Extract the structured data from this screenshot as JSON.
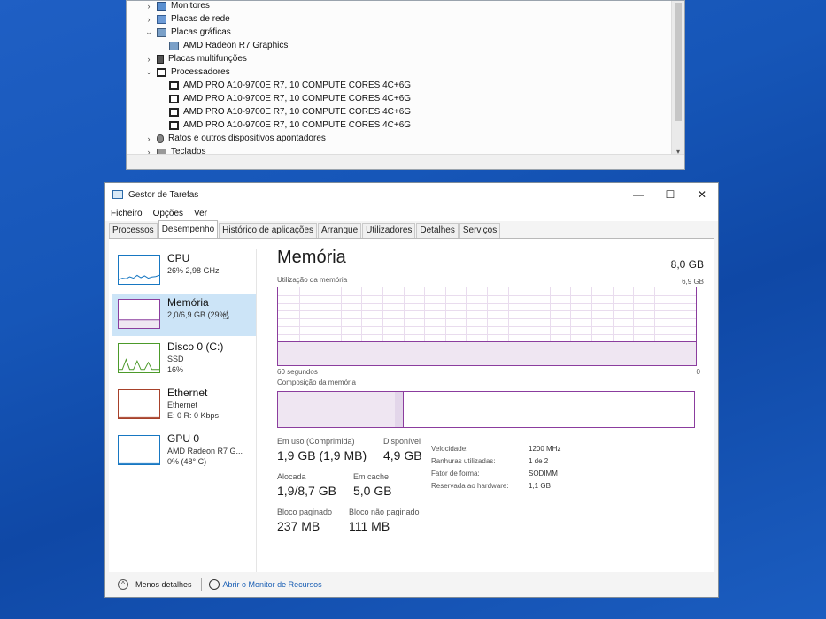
{
  "device_manager": {
    "rows": [
      {
        "chevron": ">",
        "icon": "monitor-icon",
        "label": "Monitores",
        "indent": 0
      },
      {
        "chevron": ">",
        "icon": "network-adapter-icon",
        "label": "Placas de rede",
        "indent": 0
      },
      {
        "chevron": "v",
        "icon": "display-adapter-icon",
        "label": "Placas gráficas",
        "indent": 0
      },
      {
        "chevron": "",
        "icon": "display-adapter-icon",
        "label": "AMD Radeon R7 Graphics",
        "indent": 1
      },
      {
        "chevron": ">",
        "icon": "multifunction-card-icon",
        "label": "Placas multifunções",
        "indent": 0
      },
      {
        "chevron": "v",
        "icon": "processor-icon",
        "label": "Processadores",
        "indent": 0
      },
      {
        "chevron": "",
        "icon": "processor-icon",
        "label": "AMD PRO A10-9700E R7, 10 COMPUTE CORES 4C+6G",
        "indent": 1
      },
      {
        "chevron": "",
        "icon": "processor-icon",
        "label": "AMD PRO A10-9700E R7, 10 COMPUTE CORES 4C+6G",
        "indent": 1
      },
      {
        "chevron": "",
        "icon": "processor-icon",
        "label": "AMD PRO A10-9700E R7, 10 COMPUTE CORES 4C+6G",
        "indent": 1
      },
      {
        "chevron": "",
        "icon": "processor-icon",
        "label": "AMD PRO A10-9700E R7, 10 COMPUTE CORES 4C+6G",
        "indent": 1
      },
      {
        "chevron": ">",
        "icon": "mouse-icon",
        "label": "Ratos e outros dispositivos apontadores",
        "indent": 0
      },
      {
        "chevron": ">",
        "icon": "keyboard-icon",
        "label": "Teclados",
        "indent": 0
      }
    ]
  },
  "task_manager": {
    "title": "Gestor de Tarefas",
    "window_controls": {
      "minimize": "—",
      "maximize": "☐",
      "close": "✕"
    },
    "menu": [
      "Ficheiro",
      "Opções",
      "Ver"
    ],
    "tabs": [
      "Processos",
      "Desempenho",
      "Histórico de aplicações",
      "Arranque",
      "Utilizadores",
      "Detalhes",
      "Serviços"
    ],
    "active_tab": "Desempenho",
    "sidebar": [
      {
        "name": "CPU",
        "line1": "26% 2,98 GHz",
        "line2": "",
        "color": "#1777c2"
      },
      {
        "name": "Memória",
        "line1": "2,0/6,9 GB (29%)",
        "line2": "",
        "color": "#8b3d9e"
      },
      {
        "name": "Disco 0 (C:)",
        "line1": "SSD",
        "line2": "16%",
        "color": "#4c9a2a"
      },
      {
        "name": "Ethernet",
        "line1": "Ethernet",
        "line2": "E: 0 R: 0 Kbps",
        "color": "#a7412a"
      },
      {
        "name": "GPU 0",
        "line1": "AMD Radeon R7 G...",
        "line2": "0% (48° C)",
        "color": "#1777c2"
      }
    ],
    "selected_item": "Memória",
    "memory": {
      "title": "Memória",
      "total": "8,0 GB",
      "usage_label": "Utilização da memória",
      "usage_max": "6,9 GB",
      "usage_fraction": 0.29,
      "x_left": "60 segundos",
      "x_right": "0",
      "composition_label": "Composição da memória",
      "composition_in_use_fraction": 0.28,
      "composition_modified_fraction": 0.02,
      "stats": {
        "in_use_label": "Em uso (Comprimida)",
        "in_use": "1,9 GB (1,9 MB)",
        "available_label": "Disponível",
        "available": "4,9 GB",
        "committed_label": "Alocada",
        "committed": "1,9/8,7 GB",
        "cached_label": "Em cache",
        "cached": "5,0 GB",
        "paged_label": "Bloco paginado",
        "paged": "237 MB",
        "nonpaged_label": "Bloco não paginado",
        "nonpaged": "111 MB"
      },
      "info": [
        {
          "key": "Velocidade:",
          "value": "1200 MHz"
        },
        {
          "key": "Ranhuras utilizadas:",
          "value": "1 de 2"
        },
        {
          "key": "Fator de forma:",
          "value": "SODIMM"
        },
        {
          "key": "Reservada ao hardware:",
          "value": "1,1 GB"
        }
      ]
    },
    "footer": {
      "less_details": "Menos detalhes",
      "resource_monitor": "Abrir o Monitor de Recursos"
    }
  }
}
